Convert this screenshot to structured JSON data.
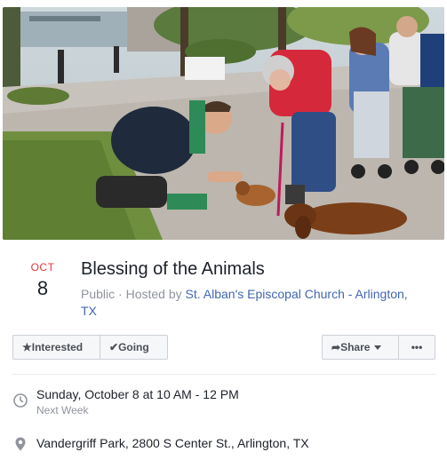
{
  "event": {
    "month": "OCT",
    "day": "8",
    "title": "Blessing of the Animals",
    "visibility": "Public",
    "separator": "·",
    "hosted_by_prefix": "Hosted by",
    "host_name": "St. Alban's Episcopal Church - Arlington, TX"
  },
  "actions": {
    "interested_label": "Interested",
    "going_label": "Going",
    "share_label": "Share",
    "more_label": "•••"
  },
  "details": {
    "when_main": "Sunday, October 8 at 10 AM - 12 PM",
    "when_sub": "Next Week",
    "where_main": "Vandergriff Park, 2800 S Center St., Arlington, TX"
  },
  "icons": {
    "interested": "star-icon",
    "going": "checkmark-icon",
    "share": "share-arrow-icon",
    "more": "more-icon",
    "time": "clock-icon",
    "location": "map-pin-icon"
  },
  "colors": {
    "month_red": "#e0393e",
    "link_blue": "#4267b2",
    "muted_gray": "#90949c",
    "button_bg": "#f6f7f9"
  }
}
